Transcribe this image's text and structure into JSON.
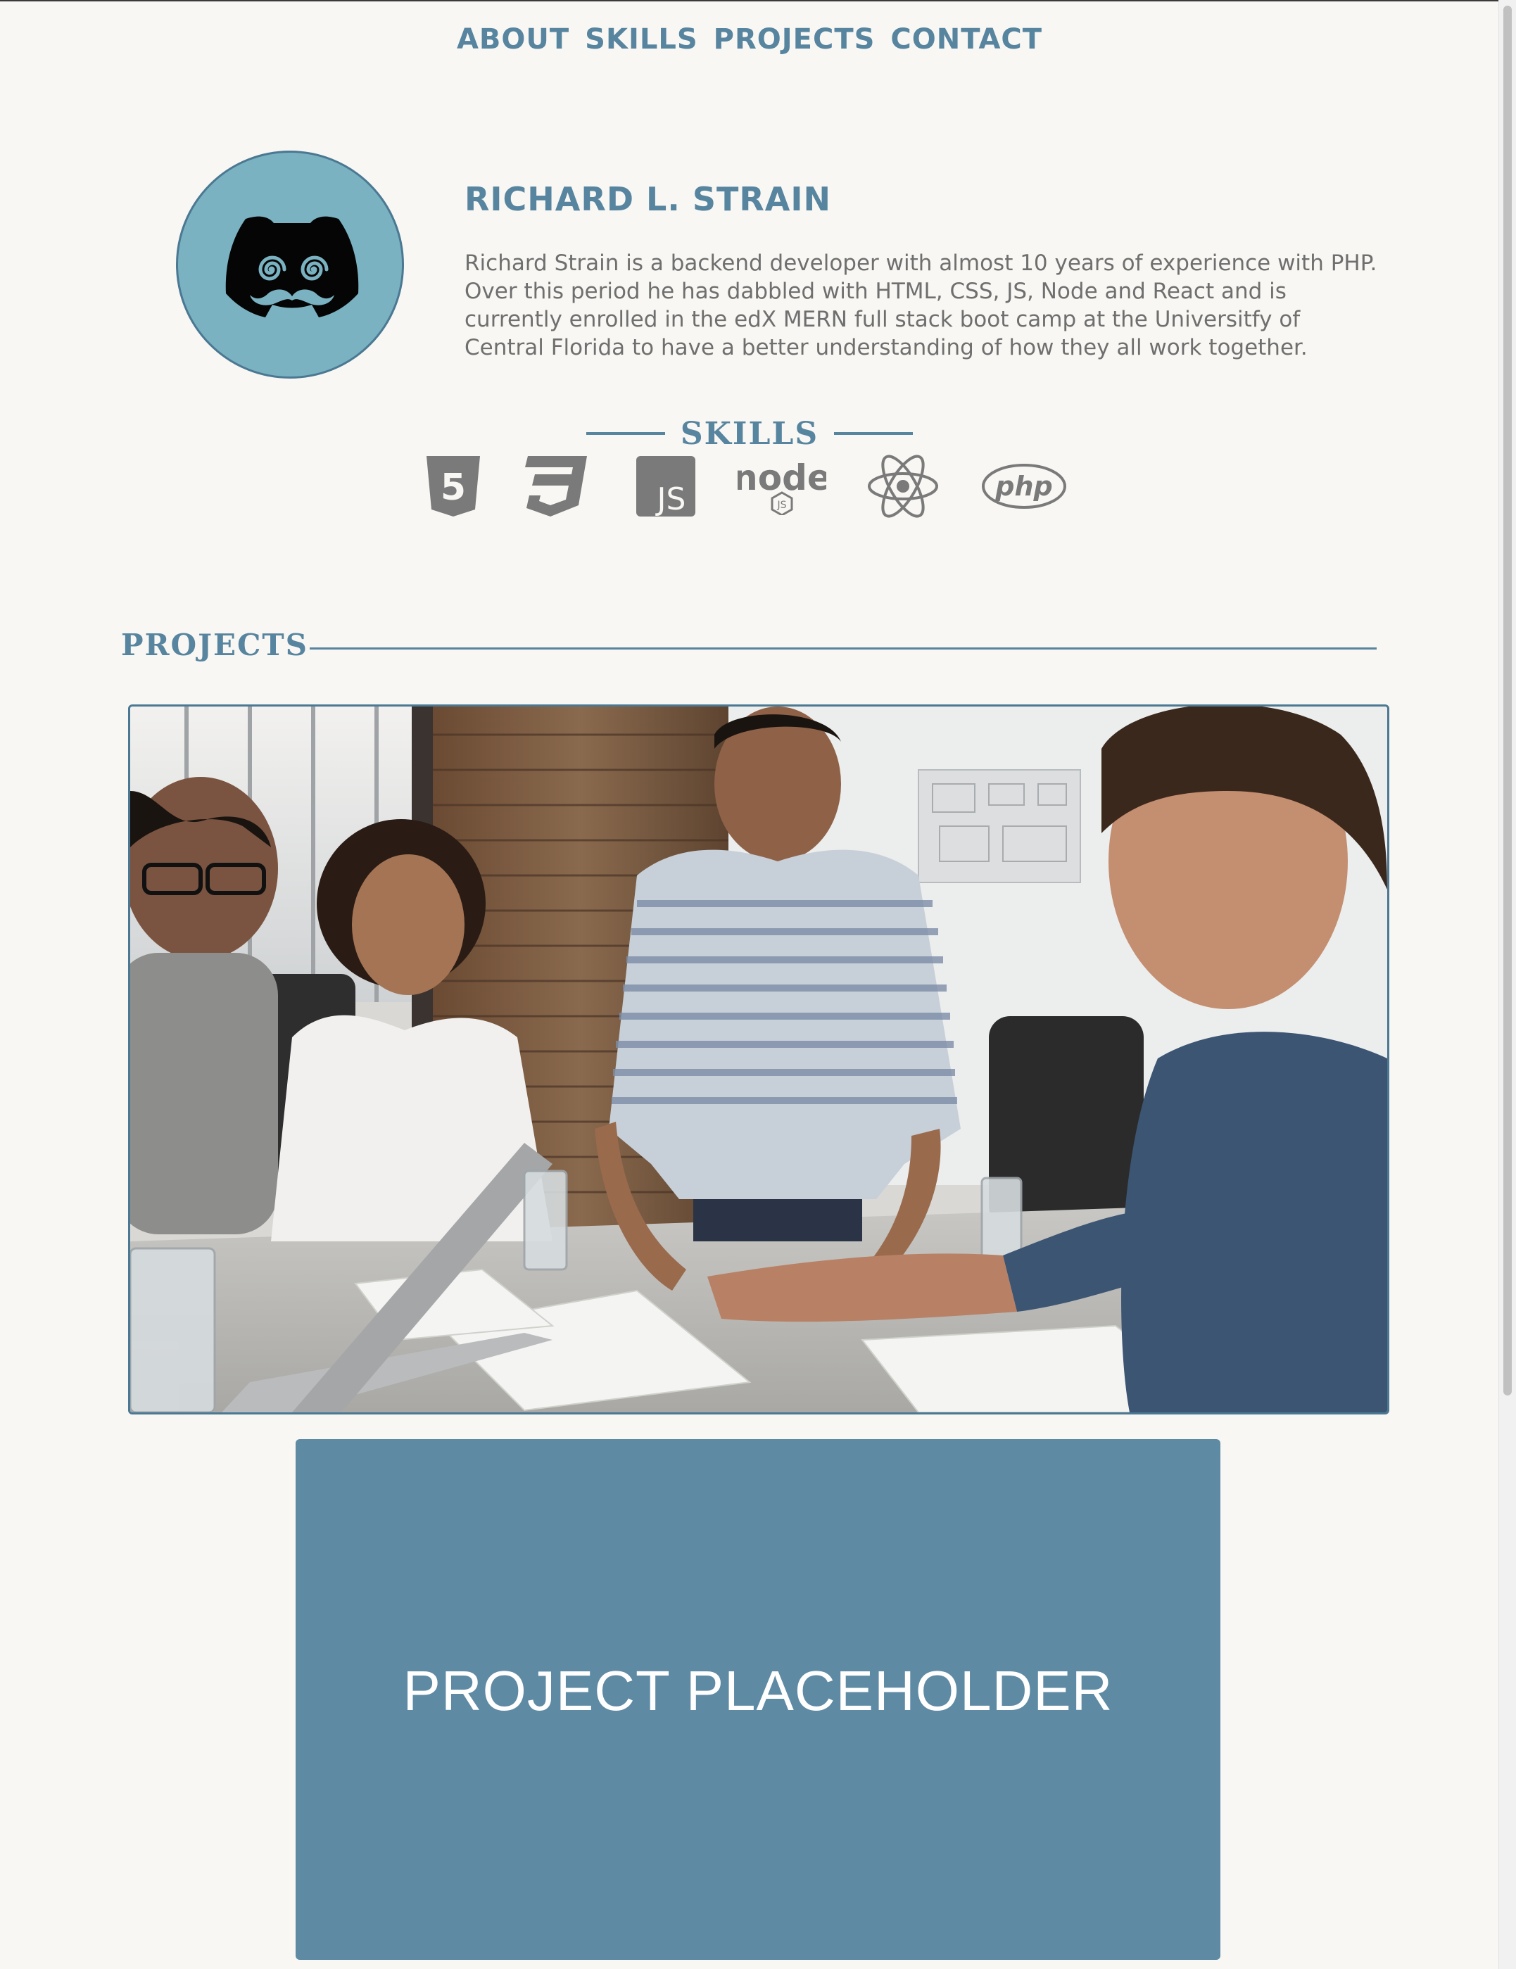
{
  "nav": {
    "items": [
      {
        "label": "ABOUT"
      },
      {
        "label": "SKILLS"
      },
      {
        "label": "PROJECTS"
      },
      {
        "label": "CONTACT"
      }
    ]
  },
  "about": {
    "name": "RICHARD L. STRAIN",
    "bio": "Richard Strain is a backend developer with almost 10 years of experience with PHP. Over this period he has dabbled with HTML, CSS, JS, Node and React and is currently enrolled in the edX MERN full stack boot camp at the Universitfy of Central Florida to have a better understanding of how they all work together.",
    "avatar_icon": "discord-mustache-icon"
  },
  "skills": {
    "title": "SKILLS",
    "items": [
      {
        "icon": "html5-icon",
        "label": "5"
      },
      {
        "icon": "css3-icon",
        "label": "3"
      },
      {
        "icon": "javascript-icon",
        "label": "JS"
      },
      {
        "icon": "nodejs-icon",
        "label": "node",
        "sublabel": "JS"
      },
      {
        "icon": "react-icon"
      },
      {
        "icon": "php-icon",
        "label": "php"
      }
    ]
  },
  "projects": {
    "title": "PROJECTS",
    "items": [
      {
        "type": "photo",
        "icon": "team-meeting-photo"
      },
      {
        "type": "placeholder",
        "label": "PROJECT PLACEHOLDER"
      }
    ]
  },
  "colors": {
    "accent": "#57849f",
    "background": "#f8f7f3",
    "text": "#6f6f6f",
    "avatar_bg": "#7ab2c1",
    "placeholder_bg": "#5e8aa4",
    "icon_gray": "#7a7a7a"
  }
}
